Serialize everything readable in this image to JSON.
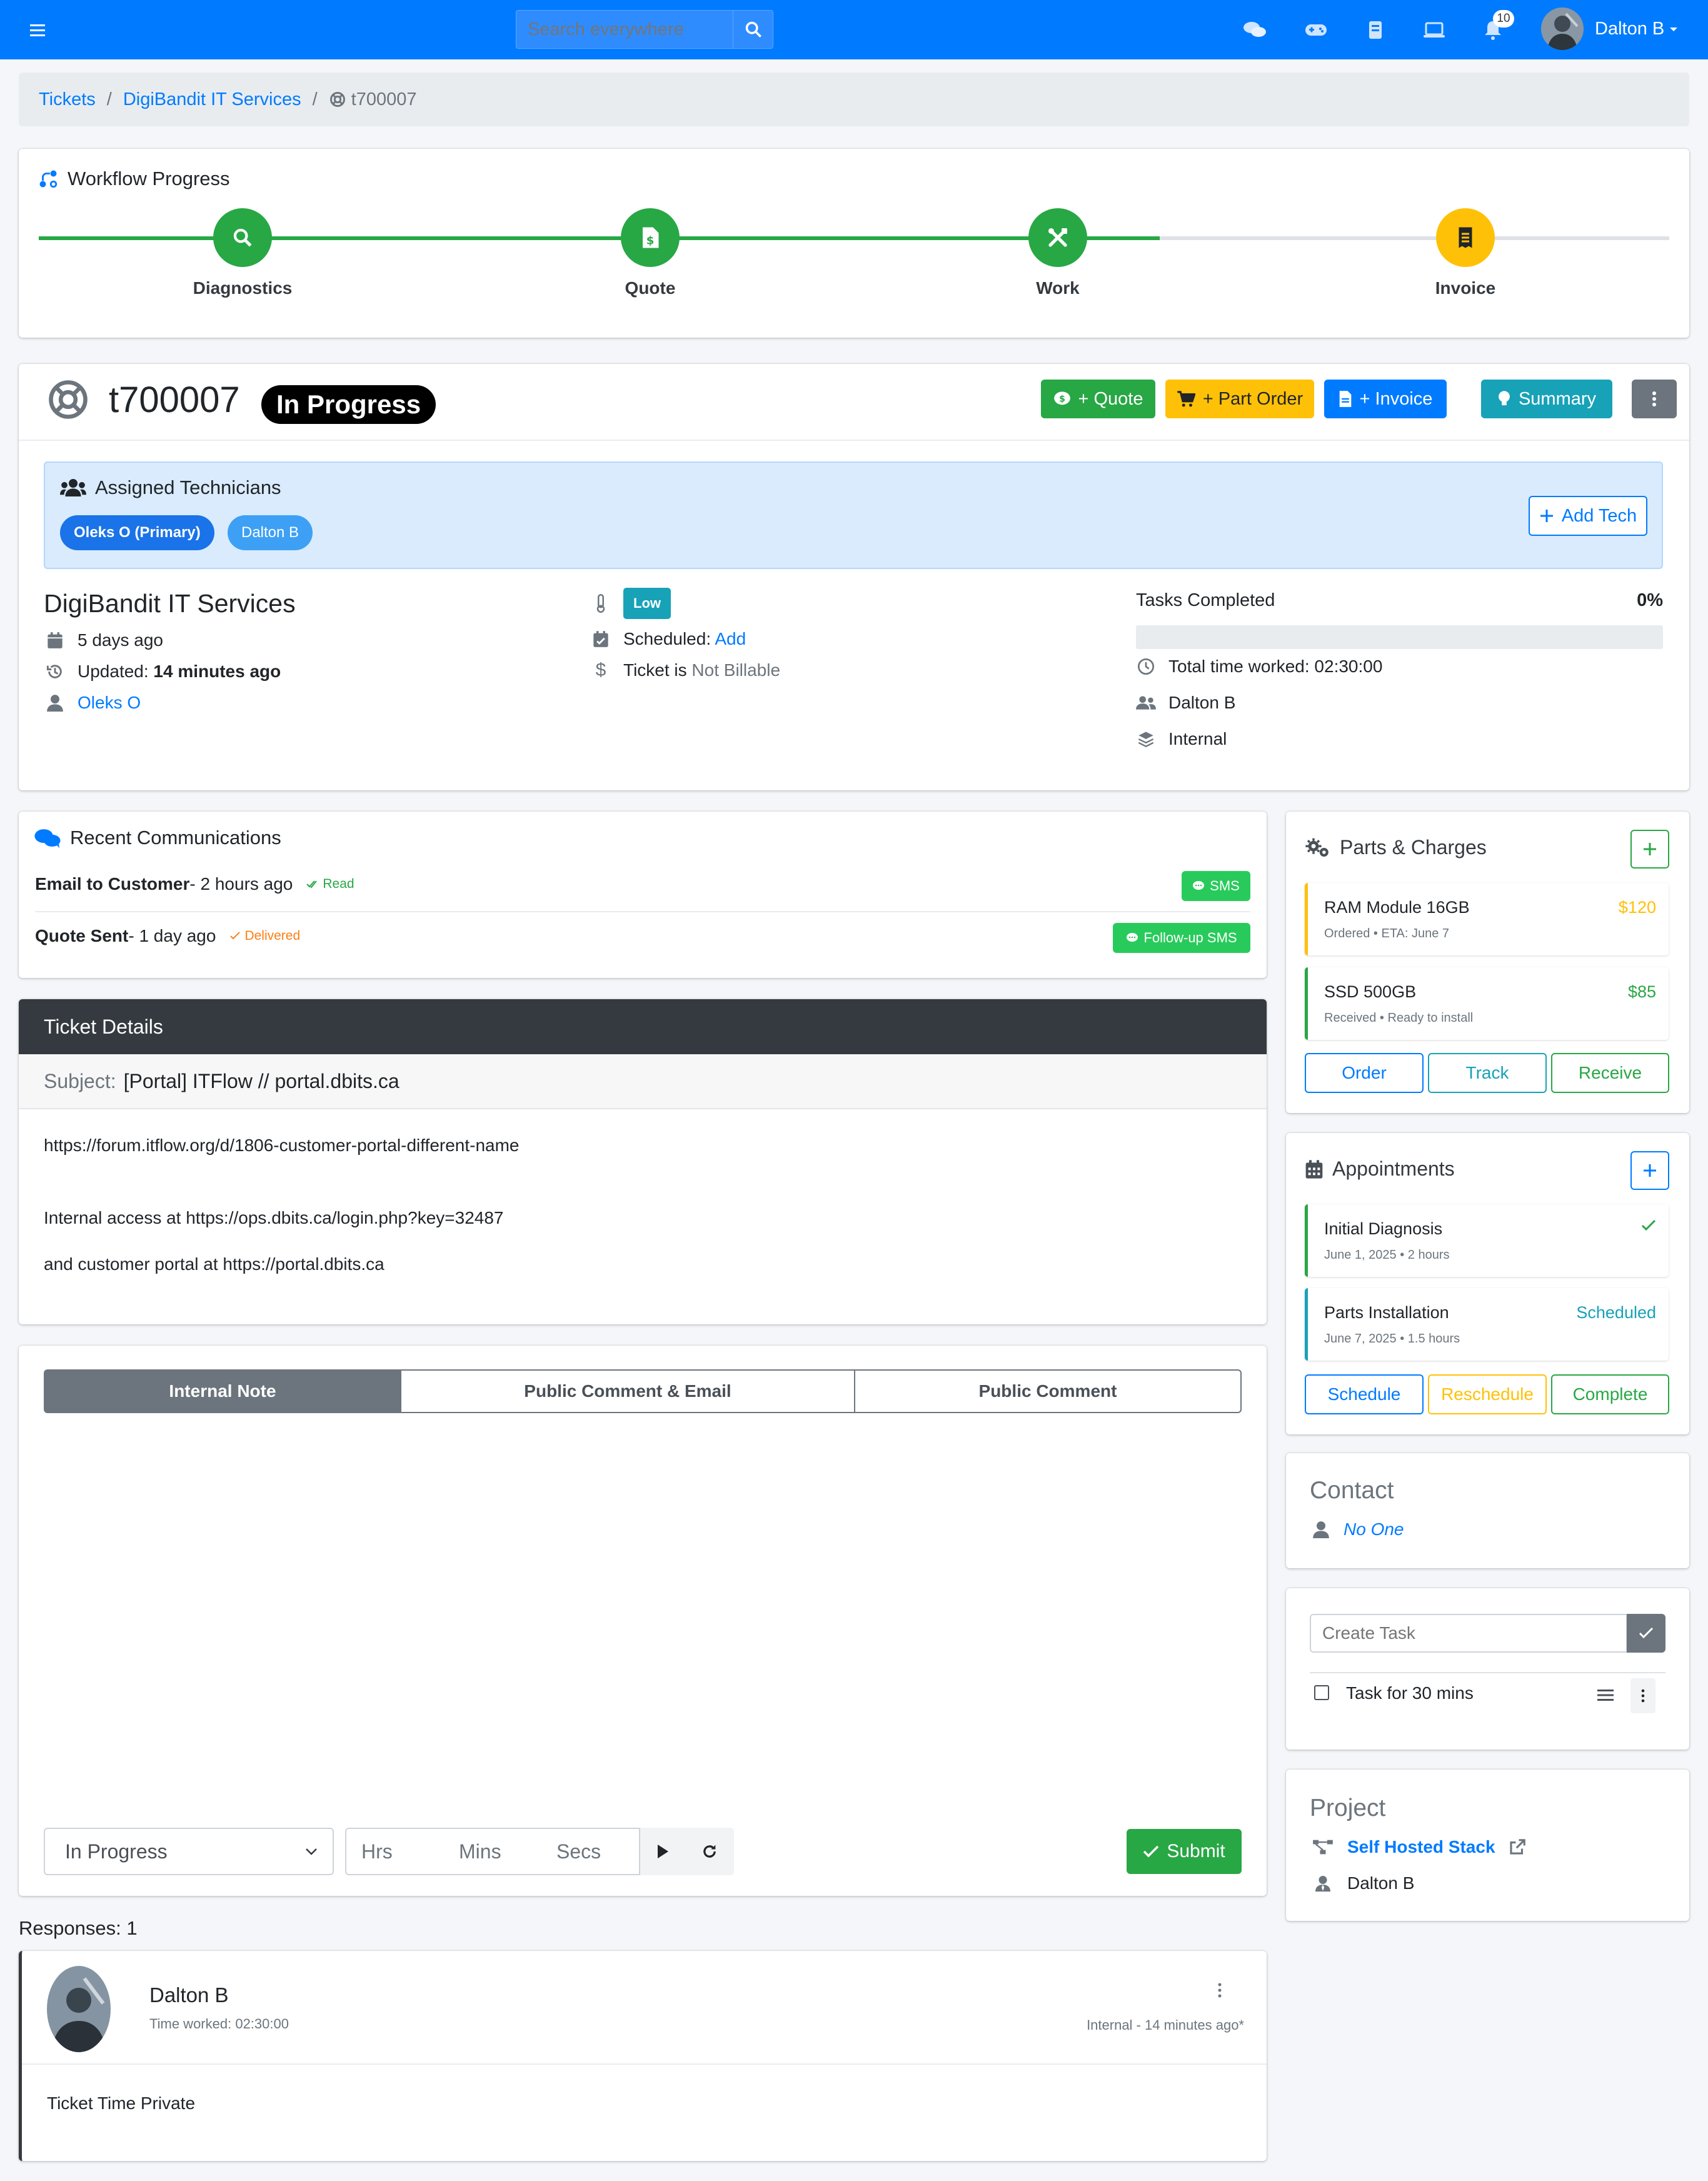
{
  "nav": {
    "search_placeholder": "Search everywhere",
    "notifications_count": "10",
    "user_name": "Dalton B"
  },
  "breadcrumb": {
    "items": [
      "Tickets",
      "DigiBandit IT Services"
    ],
    "current": "t700007"
  },
  "workflow": {
    "title": "Workflow Progress",
    "steps": [
      {
        "label": "Diagnostics",
        "status": "complete",
        "icon": "search-icon"
      },
      {
        "label": "Quote",
        "status": "complete",
        "icon": "dollar-file-icon"
      },
      {
        "label": "Work",
        "status": "complete",
        "icon": "tools-icon"
      },
      {
        "label": "Invoice",
        "status": "current",
        "icon": "receipt-icon"
      }
    ],
    "progress_fraction": 0.75
  },
  "ticket": {
    "number": "t700007",
    "status": "In Progress",
    "actions": {
      "quote": "+ Quote",
      "part_order": "+ Part Order",
      "invoice": "+ Invoice",
      "summary": "Summary"
    },
    "assigned": {
      "title": "Assigned Technicians",
      "techs": [
        "Oleks O (Primary)",
        "Dalton B"
      ],
      "add_tech": "Add Tech"
    },
    "client": "DigiBandit IT Services",
    "created": "5 days ago",
    "updated_label": "Updated: ",
    "updated_value": "14 minutes ago",
    "owner": "Oleks O",
    "priority": "Low",
    "scheduled_label": "Scheduled: ",
    "scheduled_link": "Add",
    "billable_label": "Ticket is ",
    "billable_value": "Not Billable",
    "tasks_label": "Tasks Completed",
    "tasks_percent": "0%",
    "tasks_fraction": 0,
    "time_worked": "Total time worked: 02:30:00",
    "watcher": "Dalton B",
    "category": "Internal"
  },
  "communications": {
    "title": "Recent Communications",
    "items": [
      {
        "title": "Email to Customer",
        "when": " - 2 hours ago",
        "status": "Read",
        "action": "SMS"
      },
      {
        "title": "Quote Sent",
        "when": " - 1 day ago",
        "status": "Delivered",
        "action": "Follow-up SMS"
      }
    ]
  },
  "details": {
    "header": "Ticket Details",
    "subject_label": "Subject:",
    "subject": "[Portal] ITFlow // portal.dbits.ca",
    "lines": [
      "https://forum.itflow.org/d/1806-customer-portal-different-name",
      "Internal access at https://ops.dbits.ca/login.php?key=32487",
      "and customer portal at https://portal.dbits.ca"
    ]
  },
  "reply": {
    "tabs": [
      "Internal Note",
      "Public Comment & Email",
      "Public Comment"
    ],
    "status_value": "In Progress",
    "hrs": "Hrs",
    "mins": "Mins",
    "secs": "Secs",
    "submit": "Submit"
  },
  "responses": {
    "label": "Responses: 1",
    "items": [
      {
        "author": "Dalton B",
        "time_worked": "Time worked: 02:30:00",
        "meta": "Internal - 14 minutes ago*",
        "body": "Ticket Time Private"
      }
    ]
  },
  "parts": {
    "title": "Parts & Charges",
    "items": [
      {
        "name": "RAM Module 16GB",
        "sub": "Ordered • ETA: June 7",
        "price": "$120",
        "color": "#ffc107"
      },
      {
        "name": "SSD 500GB",
        "sub": "Received • Ready to install",
        "price": "$85",
        "color": "#28a745"
      }
    ],
    "buttons": [
      "Order",
      "Track",
      "Receive"
    ]
  },
  "appointments": {
    "title": "Appointments",
    "items": [
      {
        "name": "Initial Diagnosis",
        "sub": "June 1, 2025 • 2 hours",
        "status_icon": "check-icon",
        "color": "#28a745"
      },
      {
        "name": "Parts Installation",
        "sub": "June 7, 2025 • 1.5 hours",
        "status": "Scheduled",
        "color": "#17a2b8"
      }
    ],
    "buttons": [
      "Schedule",
      "Reschedule",
      "Complete"
    ]
  },
  "contact": {
    "title": "Contact",
    "value": "No One"
  },
  "tasks": {
    "placeholder": "Create Task",
    "items": [
      {
        "label": "Task for 30 mins"
      }
    ]
  },
  "project": {
    "title": "Project",
    "name": "Self Hosted Stack",
    "manager": "Dalton B"
  },
  "colors": {
    "primary": "#007bff",
    "success": "#28a745",
    "warning": "#ffc107",
    "info": "#17a2b8",
    "secondary": "#6c757d",
    "dark": "#343a40"
  }
}
